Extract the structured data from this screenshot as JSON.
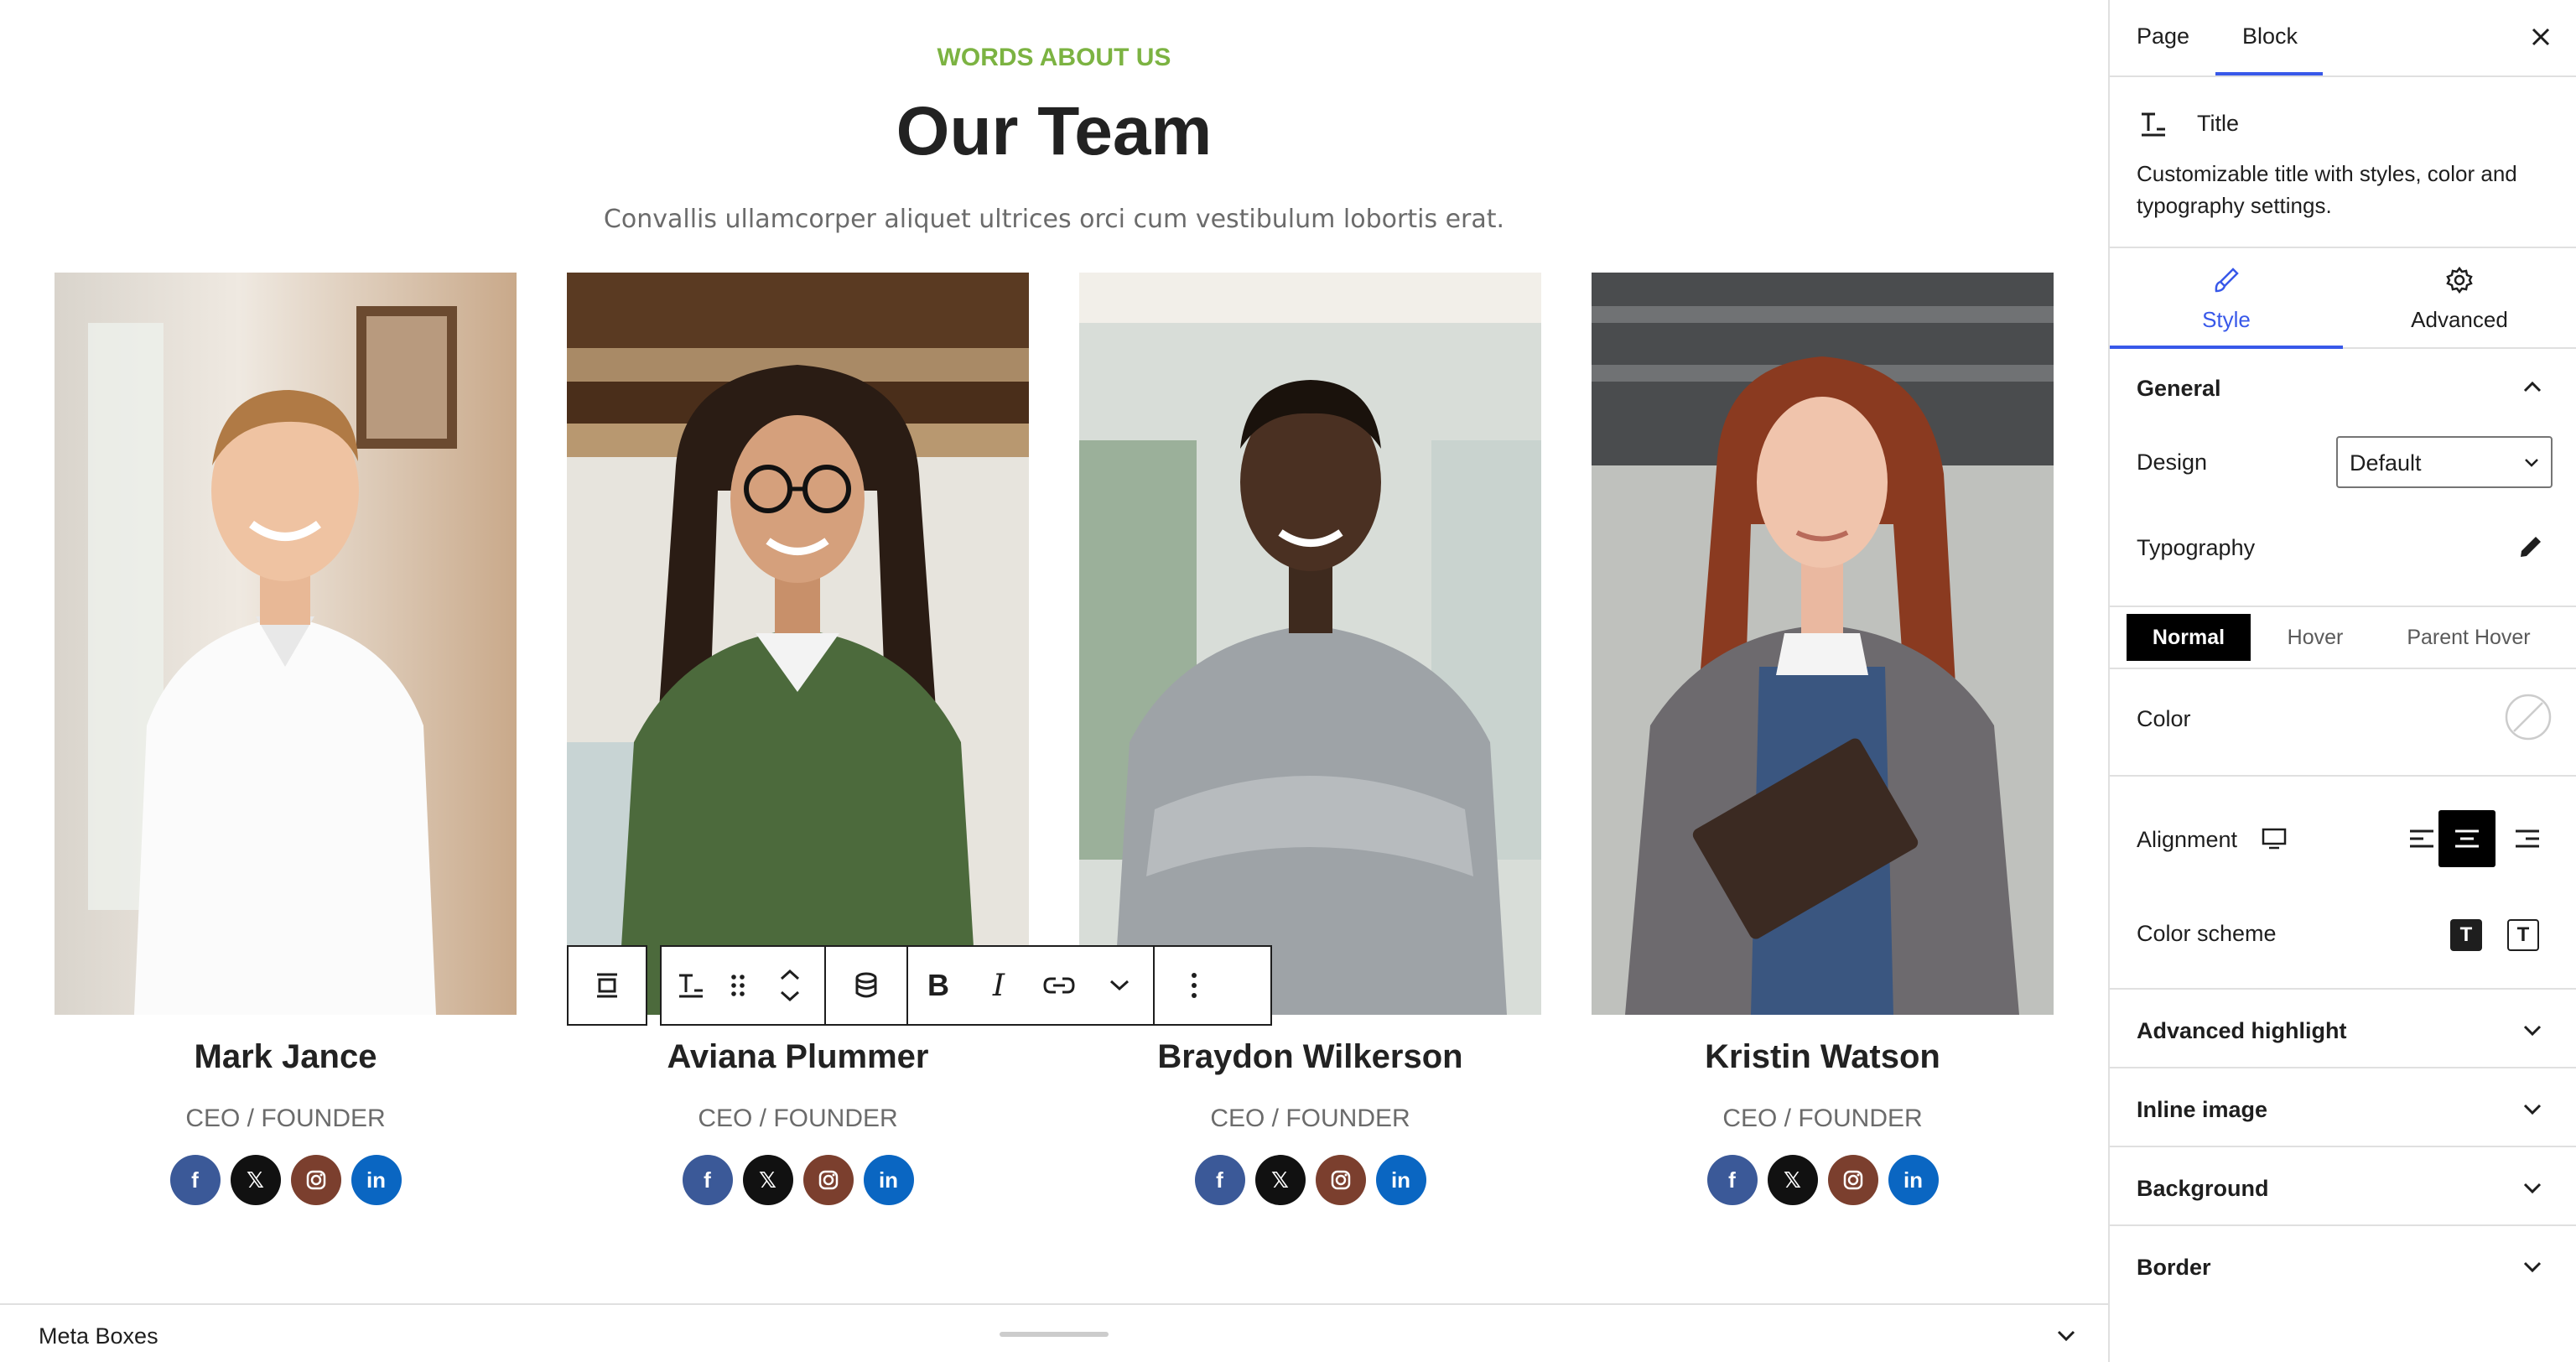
{
  "section": {
    "subtitle": "WORDS ABOUT US",
    "heading": "Our Team",
    "description": "Convallis ullamcorper aliquet ultrices orci cum vestibulum lobortis erat."
  },
  "team": [
    {
      "name": "Mark Jance",
      "role": "CEO / FOUNDER"
    },
    {
      "name": "Aviana Plummer",
      "role": "CEO / FOUNDER"
    },
    {
      "name": "Braydon Wilkerson",
      "role": "CEO / FOUNDER"
    },
    {
      "name": "Kristin Watson",
      "role": "CEO / FOUNDER"
    }
  ],
  "social_icons": [
    "facebook-icon",
    "x-icon",
    "instagram-icon",
    "linkedin-icon"
  ],
  "social_colors": {
    "facebook": "#3b5998",
    "x": "#111111",
    "instagram": "#7b3f2e",
    "linkedin": "#0a66c2"
  },
  "toolbar": {
    "icons": [
      "align-block-icon",
      "title-block-icon",
      "drag-handle-icon",
      "move-up-icon",
      "move-down-icon",
      "database-icon",
      "bold-icon",
      "italic-icon",
      "link-icon",
      "chevron-down-icon",
      "more-options-icon"
    ]
  },
  "metabox": {
    "label": "Meta Boxes"
  },
  "sidebar": {
    "tabs": [
      "Page",
      "Block"
    ],
    "active_tab": "Block",
    "block": {
      "title": "Title",
      "description": "Customizable title with styles, color and typography settings."
    },
    "style_tabs": [
      "Style",
      "Advanced"
    ],
    "general": {
      "label": "General",
      "design_label": "Design",
      "design_value": "Default",
      "typography_label": "Typography",
      "states": [
        "Normal",
        "Hover",
        "Parent Hover"
      ],
      "color_label": "Color",
      "alignment_label": "Alignment",
      "alignment_value": "center",
      "color_scheme_label": "Color scheme",
      "color_scheme_glyph": "T"
    },
    "sections": [
      "Advanced highlight",
      "Inline image",
      "Background",
      "Border"
    ]
  },
  "colors": {
    "accent": "#3858e9",
    "subtitle": "#7cb342"
  }
}
